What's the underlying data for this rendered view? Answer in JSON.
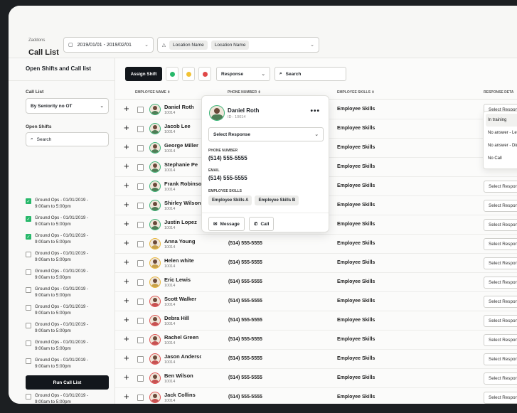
{
  "header": {
    "company": "Zaddons",
    "title": "Call List",
    "date_range": "2019/01/01 - 2019/02/01",
    "location_label": "Location Name",
    "location_value": "Location Name"
  },
  "sidebar": {
    "title": "Open Shifts and Call list",
    "call_list_label": "Call List",
    "call_list_value": "By Seniority no OT",
    "open_shifts_label": "Open Shifts",
    "search_placeholder": "Search",
    "shifts": [
      {
        "line1": "Ground Ops - 01/01/2019 -",
        "line2": "9:00am to 5:00pm",
        "checked": true
      },
      {
        "line1": "Ground Ops - 01/01/2019 -",
        "line2": "9:00am to 5:00pm",
        "checked": true
      },
      {
        "line1": "Ground Ops - 01/01/2019 -",
        "line2": "9:00am to 5:00pm",
        "checked": true
      },
      {
        "line1": "Ground Ops - 01/01/2019 -",
        "line2": "9:00am to 5:00pm",
        "checked": false
      },
      {
        "line1": "Ground Ops - 01/01/2019 -",
        "line2": "9:00am to 5:00pm",
        "checked": false
      },
      {
        "line1": "Ground Ops - 01/01/2019 -",
        "line2": "9:00am to 5:00pm",
        "checked": false
      },
      {
        "line1": "Ground Ops - 01/01/2019 -",
        "line2": "9:00am to 5:00pm",
        "checked": false
      },
      {
        "line1": "Ground Ops - 01/01/2019 -",
        "line2": "9:00am to 5:00pm",
        "checked": false
      },
      {
        "line1": "Ground Ops - 01/01/2019 -",
        "line2": "9:00am to 5:00pm",
        "checked": false
      },
      {
        "line1": "Ground Ops - 01/01/2019 -",
        "line2": "9:00am to 5:00pm",
        "checked": false
      },
      {
        "line1": "Ground Ops - 01/01/2019 -",
        "line2": "9:00am to 5:00pm",
        "checked": false
      },
      {
        "line1": "Ground Ops - 01/01/2019 -",
        "line2": "9:00am to 5:00pm",
        "checked": false
      },
      {
        "line1": "Ground Ops - 01/01/2019 -",
        "line2": "9:00am to 5:00pm",
        "checked": false
      }
    ],
    "run_button": "Run Call List"
  },
  "toolbar": {
    "assign_label": "Assign Shift",
    "status_colors": [
      "#27b86a",
      "#f2c233",
      "#e04848"
    ],
    "response_filter": "Response",
    "search_placeholder": "Search"
  },
  "table": {
    "headers": {
      "name": "EMPLOYEE NAME ⇕",
      "phone": "PHONE NUMBER ⇕",
      "skills": "EMPLOYEE SKILLS ⇕",
      "response": "RESPONSE DETA"
    },
    "rows": [
      {
        "name": "Daniel Roth",
        "id": "10014",
        "phone": "",
        "skills": "Employee Skills",
        "response": "Select Response",
        "avatar": "green"
      },
      {
        "name": "Jacob Lee",
        "id": "10014",
        "phone": "",
        "skills": "Employee Skills",
        "response": "",
        "avatar": "green"
      },
      {
        "name": "George Miller",
        "id": "10014",
        "phone": "",
        "skills": "Employee Skills",
        "response": "",
        "avatar": "green"
      },
      {
        "name": "Stephanie Pe",
        "id": "10014",
        "phone": "",
        "skills": "Employee Skills",
        "response": "",
        "avatar": "green"
      },
      {
        "name": "Frank Robinson",
        "id": "10014",
        "phone": "",
        "skills": "Employee Skills",
        "response": "Select Response",
        "avatar": "green"
      },
      {
        "name": "Shirley Wilson",
        "id": "10014",
        "phone": "",
        "skills": "Employee Skills",
        "response": "Select Response",
        "avatar": "green"
      },
      {
        "name": "Justin Lopez",
        "id": "10014",
        "phone": "",
        "skills": "Employee Skills",
        "response": "Select Response",
        "avatar": "green"
      },
      {
        "name": "Anna Young",
        "id": "10014",
        "phone": "(514) 555-5555",
        "skills": "Employee Skills",
        "response": "Select Response",
        "avatar": "yel"
      },
      {
        "name": "Helen white",
        "id": "10014",
        "phone": "(514) 555-5555",
        "skills": "Employee Skills",
        "response": "Select Response",
        "avatar": "yel"
      },
      {
        "name": "Eric Lewis",
        "id": "10014",
        "phone": "(514) 555-5555",
        "skills": "Employee Skills",
        "response": "Select Response",
        "avatar": "yel"
      },
      {
        "name": "Scott Walker",
        "id": "10014",
        "phone": "(514) 555-5555",
        "skills": "Employee Skills",
        "response": "Select Response",
        "avatar": "red"
      },
      {
        "name": "Debra Hill",
        "id": "10014",
        "phone": "(514) 555-5555",
        "skills": "Employee Skills",
        "response": "Select Response",
        "avatar": "red"
      },
      {
        "name": "Rachel Green",
        "id": "10014",
        "phone": "(514) 555-5555",
        "skills": "Employee Skills",
        "response": "Select Response",
        "avatar": "red"
      },
      {
        "name": "Jason Anderson",
        "id": "10014",
        "phone": "(514) 555-5555",
        "skills": "Employee Skills",
        "response": "Select Response",
        "avatar": "red"
      },
      {
        "name": "Ben Wilson",
        "id": "10014",
        "phone": "(514) 555-5555",
        "skills": "Employee Skills",
        "response": "Select Response",
        "avatar": "red"
      },
      {
        "name": "Jack Collins",
        "id": "10014",
        "phone": "(514) 555-5555",
        "skills": "Employee Skills",
        "response": "Select Response",
        "avatar": "red"
      }
    ]
  },
  "popup": {
    "name": "Daniel Roth",
    "id": "ID : 10014",
    "select_label": "Select Response",
    "phone_label": "PHONE NUMBER",
    "phone": "(514) 555-5555",
    "email_label": "EMAIL",
    "email": "(514) 555-5555",
    "skills_label": "EMPLOYEE SKILLS",
    "skills": [
      "Employee Skills A",
      "Employee Skills B"
    ],
    "message_label": "Message",
    "call_label": "Call"
  },
  "response_options": [
    "In training",
    "No answer - Left...",
    "No answer - Did ...",
    "No Call"
  ]
}
